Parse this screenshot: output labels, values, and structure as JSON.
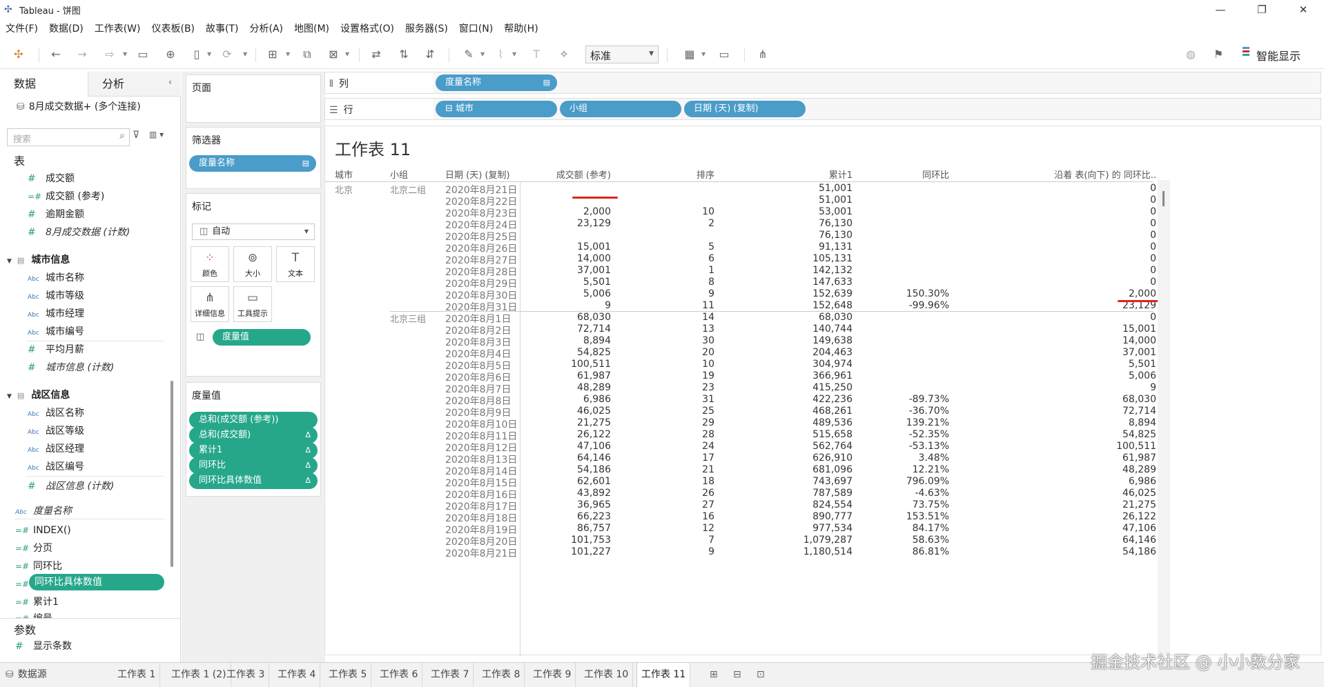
{
  "window": {
    "title": "Tableau - 饼图",
    "controls": [
      "—",
      "❐",
      "✕"
    ]
  },
  "menu": [
    "文件(F)",
    "数据(D)",
    "工作表(W)",
    "仪表板(B)",
    "故事(T)",
    "分析(A)",
    "地图(M)",
    "设置格式(O)",
    "服务器(S)",
    "窗口(N)",
    "帮助(H)"
  ],
  "toolbar": {
    "fit": "标准",
    "show_me": "智能显示"
  },
  "datapane": {
    "tab_data": "数据",
    "tab_analysis": "分析",
    "source": "8月成交数据+ (多个连接)",
    "search_placeholder": "搜索",
    "tables_heading": "表",
    "fields_main": [
      {
        "name": "成交额",
        "type": "#"
      },
      {
        "name": "成交额 (参考)",
        "type": "=#"
      },
      {
        "name": "逾期金额",
        "type": "#"
      },
      {
        "name": "8月成交数据 (计数)",
        "type": "#",
        "italic": true
      }
    ],
    "folder_city": "城市信息",
    "fields_city": [
      {
        "name": "城市名称",
        "type": "Abc"
      },
      {
        "name": "城市等级",
        "type": "Abc"
      },
      {
        "name": "城市经理",
        "type": "Abc"
      },
      {
        "name": "城市编号",
        "type": "Abc"
      },
      {
        "name": "平均月薪",
        "type": "#"
      },
      {
        "name": "城市信息 (计数)",
        "type": "#",
        "italic": true
      }
    ],
    "folder_district": "战区信息",
    "fields_district": [
      {
        "name": "战区名称",
        "type": "Abc"
      },
      {
        "name": "战区等级",
        "type": "Abc"
      },
      {
        "name": "战区经理",
        "type": "Abc"
      },
      {
        "name": "战区编号",
        "type": "Abc"
      },
      {
        "name": "战区信息 (计数)",
        "type": "#",
        "italic": true
      }
    ],
    "fields_other": [
      {
        "name": "度量名称",
        "type": "Abc",
        "italic": true
      },
      {
        "name": "INDEX()",
        "type": "=#"
      },
      {
        "name": "分页",
        "type": "=#"
      },
      {
        "name": "同环比",
        "type": "=#"
      },
      {
        "name": "同环比具体数值",
        "type": "=#",
        "selected": true
      },
      {
        "name": "累计1",
        "type": "=#"
      },
      {
        "name": "编号",
        "type": "=#"
      }
    ],
    "params_heading": "参数",
    "params": [
      {
        "name": "显示条数",
        "type": "#"
      }
    ]
  },
  "cards": {
    "pages": "页面",
    "filters": "筛选器",
    "filter_pill": "度量名称",
    "marks": "标记",
    "mark_type": "自动",
    "mark_buttons": [
      "颜色",
      "大小",
      "文本",
      "详细信息",
      "工具提示"
    ],
    "marks_pill": "度量值",
    "measure_values": "度量值",
    "measure_pills": [
      "总和(成交额 (参考))",
      "总和(成交额)",
      "累计1",
      "同环比",
      "同环比具体数值"
    ]
  },
  "shelves": {
    "columns_label": "列",
    "rows_label": "行",
    "columns": [
      "度量名称"
    ],
    "rows": [
      "城市",
      "小组",
      "日期 (天) (复制)"
    ]
  },
  "sheet": {
    "title": "工作表 11",
    "headers": [
      "城市",
      "小组",
      "日期 (天) (复制)",
      "成交额 (参考)",
      "排序",
      "累计1",
      "同环比",
      "沿着 表(向下) 的 同环比.."
    ],
    "city": "北京",
    "groups": [
      "北京二组",
      "北京三组"
    ],
    "rows": [
      [
        "2020年8月21日",
        "",
        "",
        "51,001",
        "",
        "0"
      ],
      [
        "2020年8月22日",
        "",
        "",
        "51,001",
        "",
        "0"
      ],
      [
        "2020年8月23日",
        "2,000",
        "10",
        "53,001",
        "",
        "0"
      ],
      [
        "2020年8月24日",
        "23,129",
        "2",
        "76,130",
        "",
        "0"
      ],
      [
        "2020年8月25日",
        "",
        "",
        "76,130",
        "",
        "0"
      ],
      [
        "2020年8月26日",
        "15,001",
        "5",
        "91,131",
        "",
        "0"
      ],
      [
        "2020年8月27日",
        "14,000",
        "6",
        "105,131",
        "",
        "0"
      ],
      [
        "2020年8月28日",
        "37,001",
        "1",
        "142,132",
        "",
        "0"
      ],
      [
        "2020年8月29日",
        "5,501",
        "8",
        "147,633",
        "",
        "0"
      ],
      [
        "2020年8月30日",
        "5,006",
        "9",
        "152,639",
        "150.30%",
        "2,000"
      ],
      [
        "2020年8月31日",
        "9",
        "11",
        "152,648",
        "-99.96%",
        "23,129"
      ],
      [
        "2020年8月1日",
        "68,030",
        "14",
        "68,030",
        "",
        "0"
      ],
      [
        "2020年8月2日",
        "72,714",
        "13",
        "140,744",
        "",
        "15,001"
      ],
      [
        "2020年8月3日",
        "8,894",
        "30",
        "149,638",
        "",
        "14,000"
      ],
      [
        "2020年8月4日",
        "54,825",
        "20",
        "204,463",
        "",
        "37,001"
      ],
      [
        "2020年8月5日",
        "100,511",
        "10",
        "304,974",
        "",
        "5,501"
      ],
      [
        "2020年8月6日",
        "61,987",
        "19",
        "366,961",
        "",
        "5,006"
      ],
      [
        "2020年8月7日",
        "48,289",
        "23",
        "415,250",
        "",
        "9"
      ],
      [
        "2020年8月8日",
        "6,986",
        "31",
        "422,236",
        "-89.73%",
        "68,030"
      ],
      [
        "2020年8月9日",
        "46,025",
        "25",
        "468,261",
        "-36.70%",
        "72,714"
      ],
      [
        "2020年8月10日",
        "21,275",
        "29",
        "489,536",
        "139.21%",
        "8,894"
      ],
      [
        "2020年8月11日",
        "26,122",
        "28",
        "515,658",
        "-52.35%",
        "54,825"
      ],
      [
        "2020年8月12日",
        "47,106",
        "24",
        "562,764",
        "-53.13%",
        "100,511"
      ],
      [
        "2020年8月13日",
        "64,146",
        "17",
        "626,910",
        "3.48%",
        "61,987"
      ],
      [
        "2020年8月14日",
        "54,186",
        "21",
        "681,096",
        "12.21%",
        "48,289"
      ],
      [
        "2020年8月15日",
        "62,601",
        "18",
        "743,697",
        "796.09%",
        "6,986"
      ],
      [
        "2020年8月16日",
        "43,892",
        "26",
        "787,589",
        "-4.63%",
        "46,025"
      ],
      [
        "2020年8月17日",
        "36,965",
        "27",
        "824,554",
        "73.75%",
        "21,275"
      ],
      [
        "2020年8月18日",
        "66,223",
        "16",
        "890,777",
        "153.51%",
        "26,122"
      ],
      [
        "2020年8月19日",
        "86,757",
        "12",
        "977,534",
        "84.17%",
        "47,106"
      ],
      [
        "2020年8月20日",
        "101,753",
        "7",
        "1,079,287",
        "58.63%",
        "64,146"
      ],
      [
        "2020年8月21日",
        "101,227",
        "9",
        "1,180,514",
        "86.81%",
        "54,186"
      ]
    ]
  },
  "tabs": {
    "data_source": "数据源",
    "sheets": [
      "工作表 1",
      "工作表 1 (2)",
      "工作表 3",
      "工作表 4",
      "工作表 5",
      "工作表 6",
      "工作表 7",
      "工作表 8",
      "工作表 9",
      "工作表 10",
      "工作表 11"
    ],
    "active": "工作表 11"
  },
  "watermark": "掘金技术社区 @ 小小数分家",
  "colors": {
    "pill_blue": "#4a9cc9",
    "pill_green": "#26a78a",
    "highlight_red": "#e0231b"
  }
}
